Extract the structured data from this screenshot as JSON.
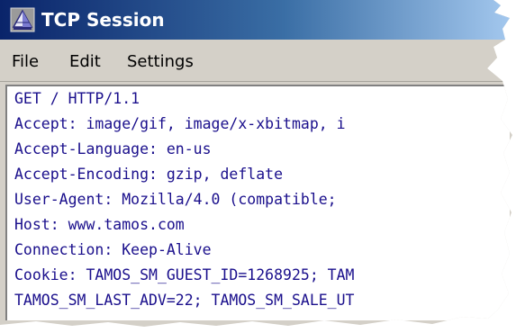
{
  "window": {
    "title": "TCP Session",
    "icon": "tamos-pyramid-icon"
  },
  "menu": {
    "items": [
      "File",
      "Edit",
      "Settings"
    ]
  },
  "session": {
    "lines": [
      "GET / HTTP/1.1",
      "Accept: image/gif, image/x-xbitmap, i",
      "Accept-Language: en-us",
      "Accept-Encoding: gzip, deflate",
      "User-Agent: Mozilla/4.0 (compatible; ",
      "Host: www.tamos.com",
      "Connection: Keep-Alive",
      "Cookie: TAMOS_SM_GUEST_ID=1268925; TAM",
      "TAMOS_SM_LAST_ADV=22; TAMOS_SM_SALE_UT"
    ]
  },
  "colors": {
    "text": "#1a0f8c",
    "titlebar_start": "#0a246a",
    "titlebar_end": "#a6caf0",
    "chrome": "#d4d0c8"
  }
}
